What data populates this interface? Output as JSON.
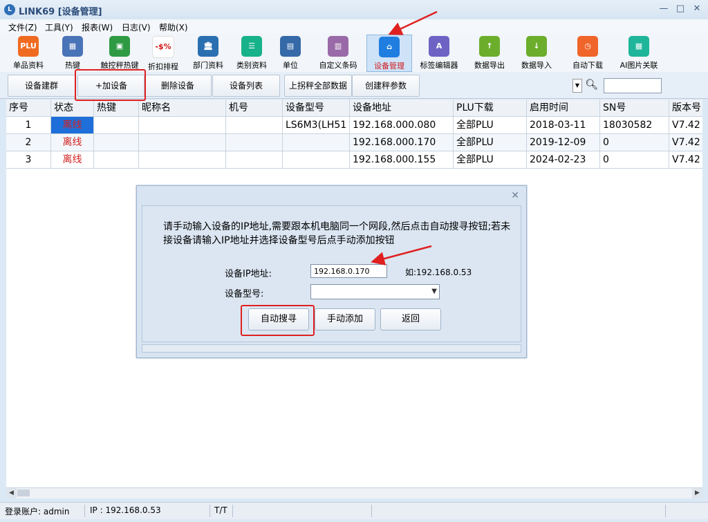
{
  "window": {
    "title": "LINK69 [设备管理]",
    "logo_text": "L",
    "controls": [
      "—",
      "□",
      "✕"
    ]
  },
  "menu": [
    "文件(Z)",
    "工具(Y)",
    "报表(W)",
    "日志(V)",
    "帮助(X)"
  ],
  "toolbar": [
    {
      "label": "单品资料",
      "icon": "plu-icon",
      "icon_text": "PLU",
      "color": "#f06b22"
    },
    {
      "label": "热键",
      "icon": "keyboard-icon",
      "icon_text": "▦",
      "color": "#4a74b8"
    },
    {
      "label": "触控秤热键",
      "icon": "touch-scale-icon",
      "icon_text": "▣",
      "color": "#2f9a44"
    },
    {
      "label": "折扣排程",
      "icon": "discount-icon",
      "icon_text": "-$%",
      "color": "#ffffff"
    },
    {
      "label": "部门资料",
      "icon": "department-icon",
      "icon_text": "🏛",
      "color": "#2a6fb0"
    },
    {
      "label": "类别资料",
      "icon": "category-icon",
      "icon_text": "☰",
      "color": "#17b28a"
    },
    {
      "label": "单位",
      "icon": "unit-icon",
      "icon_text": "▤",
      "color": "#3569a8"
    },
    {
      "label": "自定义条码",
      "icon": "barcode-icon",
      "icon_text": "▥",
      "color": "#9a6aa8"
    },
    {
      "label": "设备管理",
      "icon": "device-icon",
      "icon_text": "⌂",
      "color": "#1f7ee0"
    },
    {
      "label": "标签编辑器",
      "icon": "label-editor-icon",
      "icon_text": "A",
      "color": "#6e63c4"
    },
    {
      "label": "数据导出",
      "icon": "export-icon",
      "icon_text": "↑",
      "color": "#6cae2c"
    },
    {
      "label": "数据导入",
      "icon": "import-icon",
      "icon_text": "↓",
      "color": "#6cae2c"
    },
    {
      "label": "自动下载",
      "icon": "timer-icon",
      "icon_text": "◷",
      "color": "#f0652a"
    },
    {
      "label": "AI图片关联",
      "icon": "ai-image-icon",
      "icon_text": "▦",
      "color": "#1fb59a"
    }
  ],
  "actions": [
    "设备建群",
    "+加设备",
    "删除设备",
    "设备列表",
    "上拐秤全部数据",
    "创建秤参数"
  ],
  "table": {
    "columns": [
      "序号",
      "状态",
      "热键",
      "昵称名",
      "机号",
      "设备型号",
      "设备地址",
      "PLU下载",
      "启用时间",
      "SN号",
      "版本号"
    ],
    "rows": [
      [
        "1",
        "离线",
        "",
        "",
        "",
        "LS6M3(LH51",
        "192.168.000.080",
        "全部PLU",
        "2018-03-11",
        "18030582",
        "V7.42"
      ],
      [
        "2",
        "离线",
        "",
        "",
        "",
        "",
        "192.168.000.170",
        "全部PLU",
        "2019-12-09",
        "0",
        "V7.42"
      ],
      [
        "3",
        "离线",
        "",
        "",
        "",
        "",
        "192.168.000.155",
        "全部PLU",
        "2024-02-23",
        "0",
        "V7.42"
      ]
    ]
  },
  "dialog": {
    "message": "请手动输入设备的IP地址,需要跟本机电脑同一个网段,然后点击自动搜寻按钮;若未接设备请输入IP地址并选择设备型号后点手动添加按钮",
    "ip_label": "设备IP地址:",
    "ip_value": "192.168.0.170",
    "ip_example": "如:192.168.0.53",
    "model_label": "设备型号:",
    "model_value": "",
    "buttons": {
      "auto": "自动搜寻",
      "manual": "手动添加",
      "back": "返回"
    }
  },
  "status": {
    "account": "登录账户: admin",
    "ip": "IP : 192.168.0.53",
    "tt": "T/T"
  },
  "colors": {
    "offline_text": "#d22222",
    "selected_status_bg": "#1e6fd9",
    "annotation_red": "#e02020"
  }
}
